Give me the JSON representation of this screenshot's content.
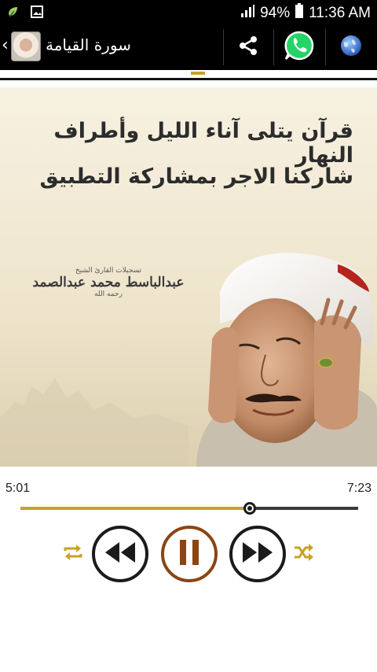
{
  "status_bar": {
    "battery": "94%",
    "time": "11:36 AM",
    "icons": [
      "app-notification-icon",
      "image-notification-icon",
      "signal-icon",
      "battery-icon"
    ]
  },
  "action_bar": {
    "title": "سورة القيامة",
    "back_glyph": "‹",
    "actions": [
      "share-icon",
      "whatsapp-icon",
      "globe-icon"
    ],
    "colors": {
      "whatsapp": "#25d366",
      "globe": "#2e6fd8"
    }
  },
  "page_indicator": {
    "count": 2,
    "active_index": 1,
    "colors": {
      "inactive": "#ffffff",
      "active": "#c9a227"
    }
  },
  "banner": {
    "line1": "قرآن يتلى آناء الليل وأطراف النهار",
    "line2": "شاركنا الاجر بمشاركة التطبيق",
    "calligraphy_caption": "تسجيلات القارئ الشيخ",
    "calligraphy_name": "عبدالباسط محمد عبدالصمد",
    "calligraphy_suffix": "رحمه الله"
  },
  "player": {
    "elapsed": "5:01",
    "duration": "7:23",
    "progress": 0.68,
    "controls": [
      "repeat-icon",
      "rewind-icon",
      "pause-icon",
      "fast-forward-icon",
      "shuffle-icon"
    ],
    "colors": {
      "accent": "#c9a227",
      "pause_ring": "#8b4513",
      "dark": "#1b1b1b"
    }
  }
}
